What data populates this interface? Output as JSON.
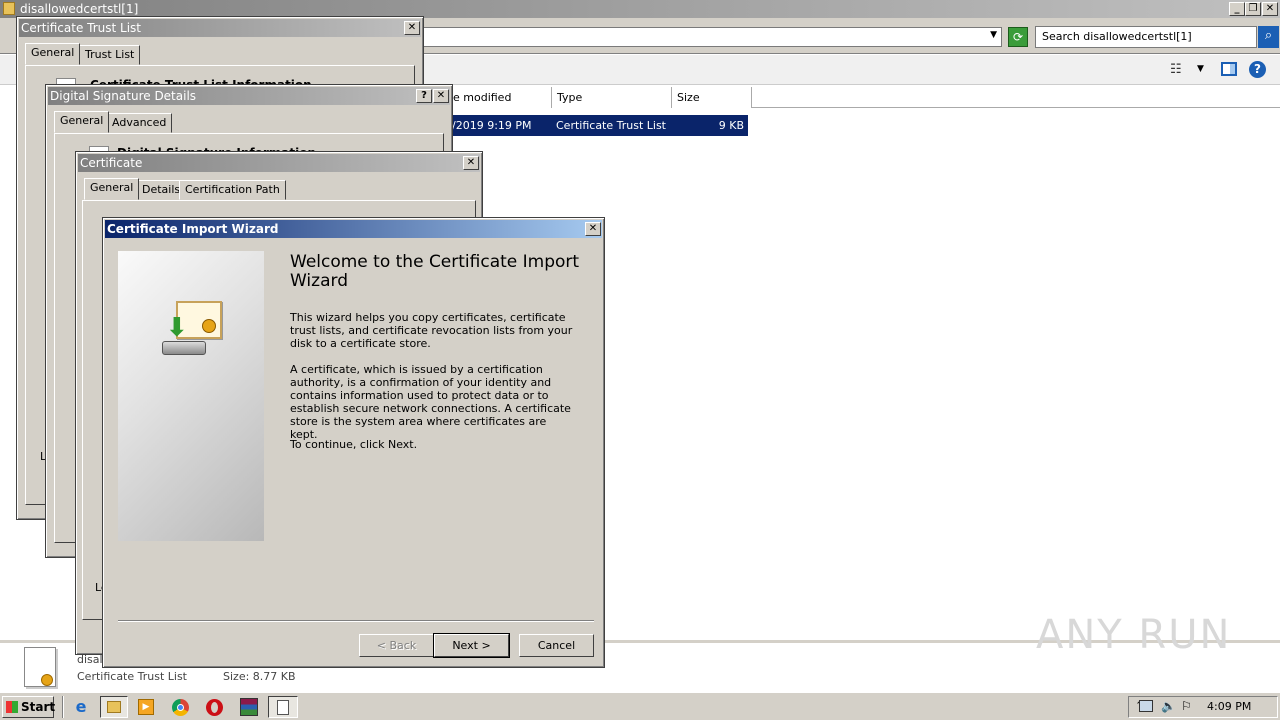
{
  "explorer": {
    "title": "disallowedcertstl[1]",
    "search_placeholder": "Search disallowedcertstl[1]",
    "columns": [
      "e modified",
      "Type",
      "Size"
    ],
    "row": {
      "date": "/2019 9:19 PM",
      "type": "Certificate Trust List",
      "size": "9 KB"
    },
    "details": {
      "name": "disall",
      "type": "Certificate Trust List",
      "size": "Size: 8.77 KB"
    }
  },
  "ctl_dialog": {
    "title": "Certificate Trust List",
    "tabs": [
      "General",
      "Trust List"
    ],
    "heading": "Certificate Trust List Information",
    "left_char": "L"
  },
  "sig_dialog": {
    "title": "Digital Signature Details",
    "tabs": [
      "General",
      "Advanced"
    ],
    "heading": "Digital Signature Information",
    "help_label": "?"
  },
  "cert_dialog": {
    "title": "Certificate",
    "tabs": [
      "General",
      "Details",
      "Certification Path"
    ],
    "left_char": "Le"
  },
  "wizard": {
    "title": "Certificate Import Wizard",
    "heading": "Welcome to the Certificate Import Wizard",
    "para1": "This wizard helps you copy certificates, certificate trust lists, and certificate revocation lists from your disk to a certificate store.",
    "para2": "A certificate, which is issued by a certification authority, is a confirmation of your identity and contains information used to protect data or to establish secure network connections. A certificate store is the system area where certificates are kept.",
    "para3": "To continue, click Next.",
    "back_label": "< Back",
    "next_label": "Next >",
    "cancel_label": "Cancel"
  },
  "taskbar": {
    "start_label": "Start",
    "clock": "4:09 PM"
  },
  "watermark": "ANY RUN",
  "colors": {
    "wizard_title_start": "#0a246a",
    "wizard_title_end": "#a6caf0",
    "selection": "#0a246a",
    "dialog_bg": "#d4d0c8"
  }
}
